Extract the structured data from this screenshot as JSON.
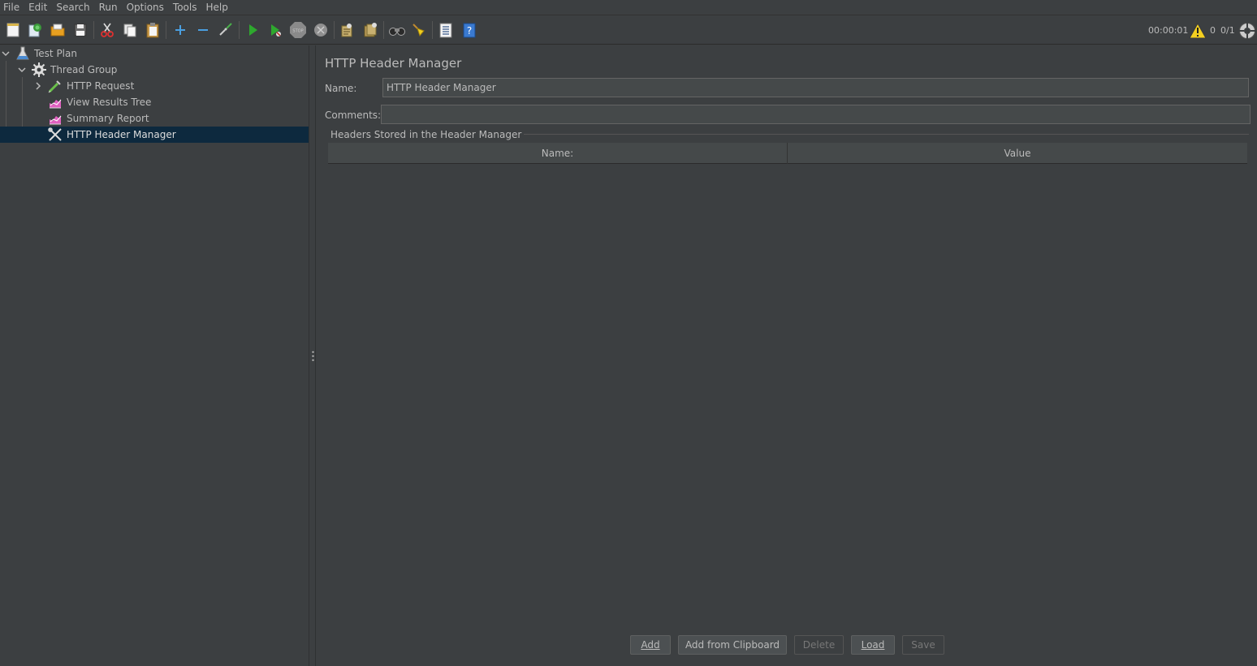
{
  "menu": [
    {
      "label": "File"
    },
    {
      "label": "Edit"
    },
    {
      "label": "Search"
    },
    {
      "label": "Run"
    },
    {
      "label": "Options"
    },
    {
      "label": "Tools"
    },
    {
      "label": "Help"
    }
  ],
  "toolbar": {
    "icons": [
      "new-icon",
      "templates-icon",
      "open-icon",
      "save-icon",
      "cut-icon",
      "copy-icon",
      "paste-icon",
      "expand-icon",
      "collapse-icon",
      "toggle-icon",
      "start-icon",
      "start-no-pauses-icon",
      "stop-icon",
      "shutdown-icon",
      "clear-icon",
      "clear-all-icon",
      "search-icon",
      "reset-search-icon",
      "function-helper-icon",
      "help-icon"
    ]
  },
  "status": {
    "elapsed": "00:00:01",
    "warnings": "0",
    "threads": "0/1"
  },
  "tree": {
    "items": [
      {
        "label": "Test Plan",
        "icon": "test-plan-icon"
      },
      {
        "label": "Thread Group",
        "icon": "gear-icon"
      },
      {
        "label": "HTTP Request",
        "icon": "pipette-icon"
      },
      {
        "label": "View Results Tree",
        "icon": "chart-icon"
      },
      {
        "label": "Summary Report",
        "icon": "chart-icon"
      },
      {
        "label": "HTTP Header Manager",
        "icon": "wrench-icon"
      }
    ]
  },
  "panel": {
    "title": "HTTP Header Manager",
    "name_label": "Name:",
    "name_value": "HTTP Header Manager",
    "comments_label": "Comments:",
    "comments_value": "",
    "group_title": "Headers Stored in the Header Manager",
    "columns": [
      "Name:",
      "Value"
    ]
  },
  "buttons": {
    "add": "Add",
    "add_from_clipboard": "Add from Clipboard",
    "delete": "Delete",
    "load": "Load",
    "save": "Save"
  }
}
